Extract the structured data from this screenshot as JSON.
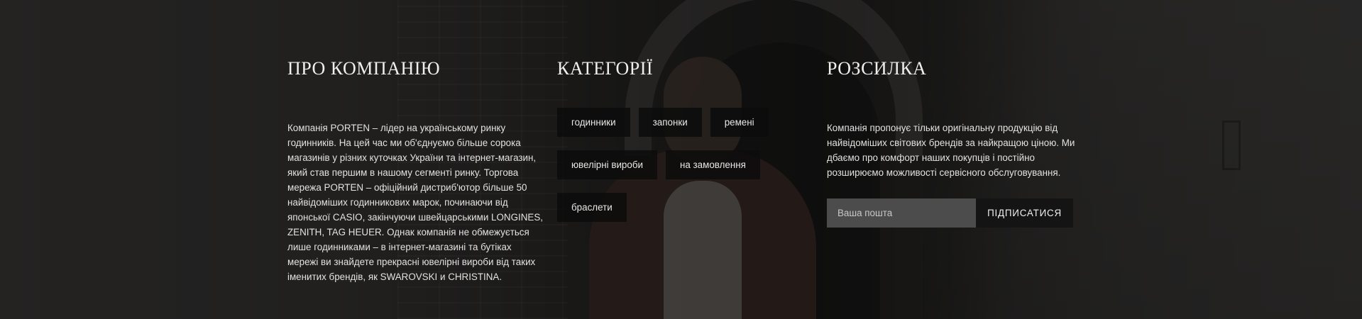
{
  "about": {
    "title": "ПРО КОМПАНІЮ",
    "text": "Компанія PORTEN – лідер на українському ринку годинників. На цей час ми об'єднуємо більше сорока магазинів у різних куточках України та інтернет-магазин, який став першим в нашому сегменті ринку. Торгова мережа PORTEN – офіційний дистриб'ютор більше 50 найвідоміших годинникових марок, починаючи від японської CASIO, закінчуючи швейцарськими LONGINES, ZENITH, TAG HEUER. Однак компанія не обмежується лише годинниками – в інтернет-магазині та бутіках мережі ви знайдете прекрасні ювелірні вироби від таких іменитих брендів, як SWAROVSKI и CHRISTINA."
  },
  "categories": {
    "title": "КАТЕГОРІЇ",
    "items": [
      {
        "label": "годинники"
      },
      {
        "label": "запонки"
      },
      {
        "label": "ремені"
      },
      {
        "label": "ювелірні вироби"
      },
      {
        "label": "на замовлення"
      },
      {
        "label": "браслети"
      }
    ]
  },
  "newsletter": {
    "title": "РОЗСИЛКА",
    "text": "Компанія пропонує тільки оригінальну продукцію від найвідоміших світових брендів за найкращою ціною. Ми дбаємо про комфорт наших покупців і постійно розширюємо можливості сервісного обслуговування.",
    "email_placeholder": "Ваша пошта",
    "email_value": "",
    "subscribe_label": "ПІДПИСАТИСЯ"
  },
  "colors": {
    "overlay": "#101010",
    "tag_background": "#0c0c0c",
    "input_background": "#4c4c4c",
    "button_background": "#141414",
    "text": "#e4e2df"
  }
}
